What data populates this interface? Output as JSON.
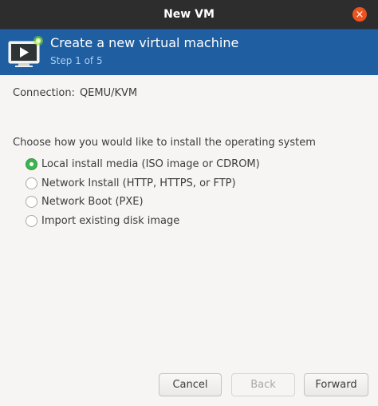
{
  "window": {
    "title": "New VM",
    "close_glyph": "×"
  },
  "banner": {
    "title": "Create a new virtual machine",
    "step": "Step 1 of 5",
    "icon": "virtual-machine-icon"
  },
  "connection": {
    "label": "Connection:",
    "value": "QEMU/KVM"
  },
  "install": {
    "instruction": "Choose how you would like to install the operating system",
    "options": [
      {
        "label": "Local install media (ISO image or CDROM)",
        "selected": true
      },
      {
        "label": "Network Install (HTTP, HTTPS, or FTP)",
        "selected": false
      },
      {
        "label": "Network Boot (PXE)",
        "selected": false
      },
      {
        "label": "Import existing disk image",
        "selected": false
      }
    ]
  },
  "buttons": {
    "cancel": "Cancel",
    "back": "Back",
    "forward": "Forward"
  },
  "colors": {
    "titlebar": "#2d2d2d",
    "banner": "#1f5fa1",
    "close": "#e95420",
    "radio_selected": "#3eb34f"
  }
}
